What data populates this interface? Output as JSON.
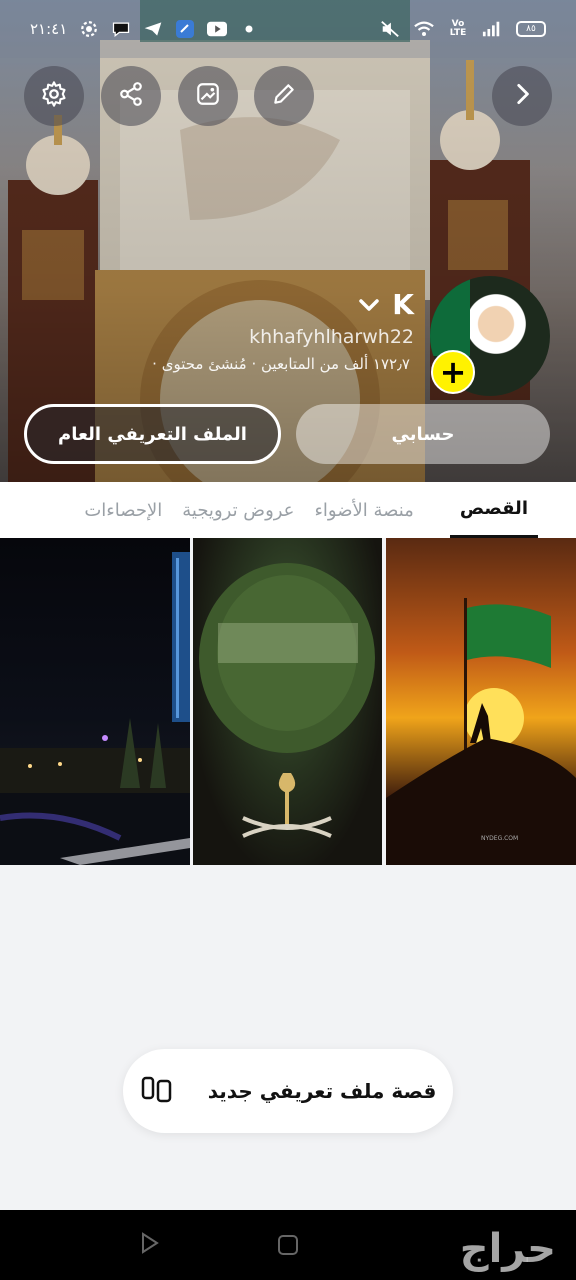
{
  "statusbar": {
    "time": "٢١:٤١",
    "battery": "٨٥"
  },
  "header": {
    "actions": [
      "back",
      "edit",
      "image",
      "share",
      "settings"
    ]
  },
  "profile": {
    "display_name": "K",
    "username": "khhafyhlharwh22",
    "followers": "١٧٢٫٧ ألف من المتابعين",
    "role": "مُنشئ محتوى",
    "meta_sep": "·",
    "add_icon": "+",
    "account_button": "حسابي",
    "public_profile_button": "الملف التعريفي العام"
  },
  "tabs": [
    {
      "label": "القصص",
      "active": true
    },
    {
      "label": "منصة الأضواء",
      "active": false
    },
    {
      "label": "عروض ترويجية",
      "active": false
    },
    {
      "label": "الإحصاءات",
      "active": false
    }
  ],
  "stories": {
    "s3_credit": "NYDEG.COM"
  },
  "new_story": {
    "label": "قصة ملف تعريفي جديد"
  },
  "navbar": {
    "watermark": "حراج"
  },
  "colors": {
    "accent_yellow": "#FFF200",
    "tab_active": "#111111",
    "tab_inactive": "#9AA0A6"
  }
}
